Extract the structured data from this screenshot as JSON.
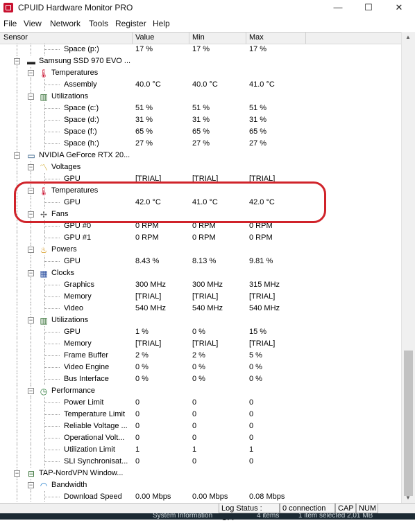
{
  "window": {
    "title": "CPUID Hardware Monitor PRO",
    "min_glyph": "—",
    "max_glyph": "☐",
    "close_glyph": "✕"
  },
  "menu": [
    "File",
    "View",
    "Network",
    "Tools",
    "Register",
    "Help"
  ],
  "columns": {
    "sensor": "Sensor",
    "value": "Value",
    "min": "Min",
    "max": "Max"
  },
  "rows": [
    {
      "level": 3,
      "label": "Space (p:)",
      "value": "17 %",
      "min": "17 %",
      "max": "17 %"
    },
    {
      "level": 1,
      "label": "Samsung SSD 970 EVO ...",
      "icon": "ssd-icon",
      "toggle": "−"
    },
    {
      "level": 2,
      "label": "Temperatures",
      "icon": "thermometer-icon",
      "toggle": "−"
    },
    {
      "level": 3,
      "label": "Assembly",
      "value": "40.0 °C",
      "min": "40.0 °C",
      "max": "41.0 °C"
    },
    {
      "level": 2,
      "label": "Utilizations",
      "icon": "utilization-icon",
      "toggle": "−"
    },
    {
      "level": 3,
      "label": "Space (c:)",
      "value": "51 %",
      "min": "51 %",
      "max": "51 %"
    },
    {
      "level": 3,
      "label": "Space (d:)",
      "value": "31 %",
      "min": "31 %",
      "max": "31 %"
    },
    {
      "level": 3,
      "label": "Space (f:)",
      "value": "65 %",
      "min": "65 %",
      "max": "65 %"
    },
    {
      "level": 3,
      "label": "Space (h:)",
      "value": "27 %",
      "min": "27 %",
      "max": "27 %"
    },
    {
      "level": 1,
      "label": "NVIDIA GeForce RTX 20...",
      "icon": "gpu-icon",
      "toggle": "−"
    },
    {
      "level": 2,
      "label": "Voltages",
      "icon": "voltage-icon",
      "toggle": "−"
    },
    {
      "level": 3,
      "label": "GPU",
      "value": "[TRIAL]",
      "min": "[TRIAL]",
      "max": "[TRIAL]"
    },
    {
      "level": 2,
      "label": "Temperatures",
      "icon": "thermometer-icon",
      "toggle": "−"
    },
    {
      "level": 3,
      "label": "GPU",
      "value": "42.0 °C",
      "min": "41.0 °C",
      "max": "42.0 °C"
    },
    {
      "level": 2,
      "label": "Fans",
      "icon": "fan-icon",
      "toggle": "−"
    },
    {
      "level": 3,
      "label": "GPU #0",
      "value": "0 RPM",
      "min": "0 RPM",
      "max": "0 RPM"
    },
    {
      "level": 3,
      "label": "GPU #1",
      "value": "0 RPM",
      "min": "0 RPM",
      "max": "0 RPM"
    },
    {
      "level": 2,
      "label": "Powers",
      "icon": "power-icon",
      "toggle": "−"
    },
    {
      "level": 3,
      "label": "GPU",
      "value": "8.43 %",
      "min": "8.13 %",
      "max": "9.81 %"
    },
    {
      "level": 2,
      "label": "Clocks",
      "icon": "clock-icon",
      "toggle": "−"
    },
    {
      "level": 3,
      "label": "Graphics",
      "value": "300 MHz",
      "min": "300 MHz",
      "max": "315 MHz"
    },
    {
      "level": 3,
      "label": "Memory",
      "value": "[TRIAL]",
      "min": "[TRIAL]",
      "max": "[TRIAL]"
    },
    {
      "level": 3,
      "label": "Video",
      "value": "540 MHz",
      "min": "540 MHz",
      "max": "540 MHz"
    },
    {
      "level": 2,
      "label": "Utilizations",
      "icon": "utilization-icon",
      "toggle": "−"
    },
    {
      "level": 3,
      "label": "GPU",
      "value": "1 %",
      "min": "0 %",
      "max": "15 %"
    },
    {
      "level": 3,
      "label": "Memory",
      "value": "[TRIAL]",
      "min": "[TRIAL]",
      "max": "[TRIAL]"
    },
    {
      "level": 3,
      "label": "Frame Buffer",
      "value": "2 %",
      "min": "2 %",
      "max": "5 %"
    },
    {
      "level": 3,
      "label": "Video Engine",
      "value": "0 %",
      "min": "0 %",
      "max": "0 %"
    },
    {
      "level": 3,
      "label": "Bus Interface",
      "value": "0 %",
      "min": "0 %",
      "max": "0 %"
    },
    {
      "level": 2,
      "label": "Performance",
      "icon": "performance-icon",
      "toggle": "−"
    },
    {
      "level": 3,
      "label": "Power Limit",
      "value": "0",
      "min": "0",
      "max": "0"
    },
    {
      "level": 3,
      "label": "Temperature Limit",
      "value": "0",
      "min": "0",
      "max": "0"
    },
    {
      "level": 3,
      "label": "Reliable Voltage ...",
      "value": "0",
      "min": "0",
      "max": "0"
    },
    {
      "level": 3,
      "label": "Operational Volt...",
      "value": "0",
      "min": "0",
      "max": "0"
    },
    {
      "level": 3,
      "label": "Utilization Limit",
      "value": "1",
      "min": "1",
      "max": "1"
    },
    {
      "level": 3,
      "label": "SLI Synchronisat...",
      "value": "0",
      "min": "0",
      "max": "0"
    },
    {
      "level": 1,
      "label": "TAP-NordVPN Window...",
      "icon": "network-adapter-icon",
      "toggle": "−"
    },
    {
      "level": 2,
      "label": "Bandwidth",
      "icon": "wifi-icon",
      "toggle": "−"
    },
    {
      "level": 3,
      "label": "Download Speed",
      "value": "0.00 Mbps",
      "min": "0.00 Mbps",
      "max": "0.08 Mbps"
    }
  ],
  "status": {
    "log": "Log Status : OFF",
    "connection": "0 connection",
    "cap": "CAP",
    "num": "NUM"
  },
  "taskbar": {
    "items_text": "4 items",
    "selected_text": "1 item selected  2,01 MB",
    "sysinfo_text": "System Information"
  },
  "colors": {
    "highlight": "#d0232a",
    "thermometer": "#c8102e",
    "app_icon": "#c8102e"
  }
}
